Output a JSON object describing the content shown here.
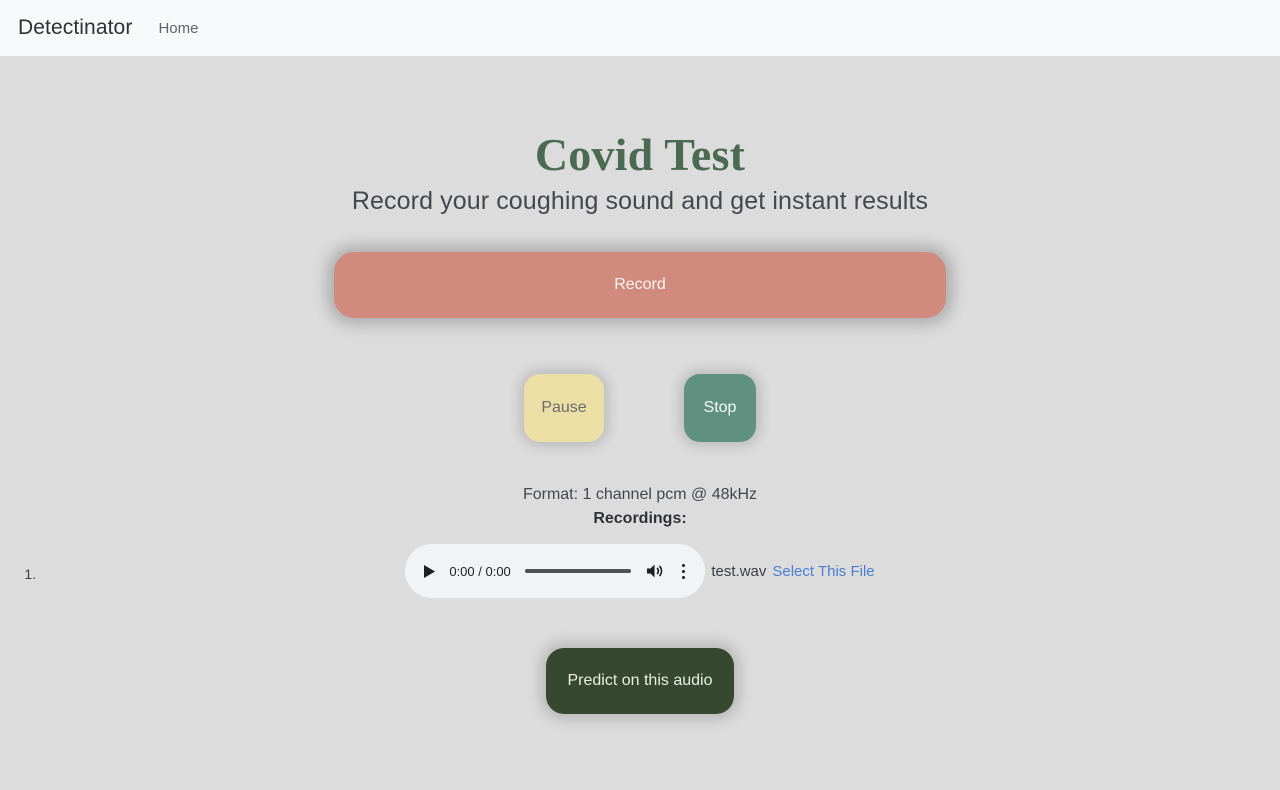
{
  "navbar": {
    "brand": "Detectinator",
    "links": [
      {
        "label": "Home",
        "name": "nav-link-home"
      }
    ]
  },
  "hero": {
    "title": "Covid Test",
    "subtitle": "Record your coughing sound and get instant results",
    "title_color": "#4a6a51"
  },
  "controls": {
    "record_label": "Record",
    "record_color": "#d08a7e",
    "pause_label": "Pause",
    "pause_color": "#ecdfa6",
    "stop_label": "Stop",
    "stop_color": "#5f9080",
    "predict_label": "Predict on this audio",
    "predict_color": "#36482f"
  },
  "status": {
    "format_text": "Format: 1 channel pcm @ 48kHz",
    "recordings_label": "Recordings:"
  },
  "recordings": [
    {
      "index": "1.",
      "player": {
        "play_icon": "play-icon",
        "time": "0:00 / 0:00",
        "progress_percent": 0,
        "volume_icon": "volume-icon",
        "menu_icon": "kebab-menu-icon"
      },
      "file_name": "test.wav",
      "select_link": "Select This File",
      "link_color": "#4a7fd4"
    }
  ]
}
